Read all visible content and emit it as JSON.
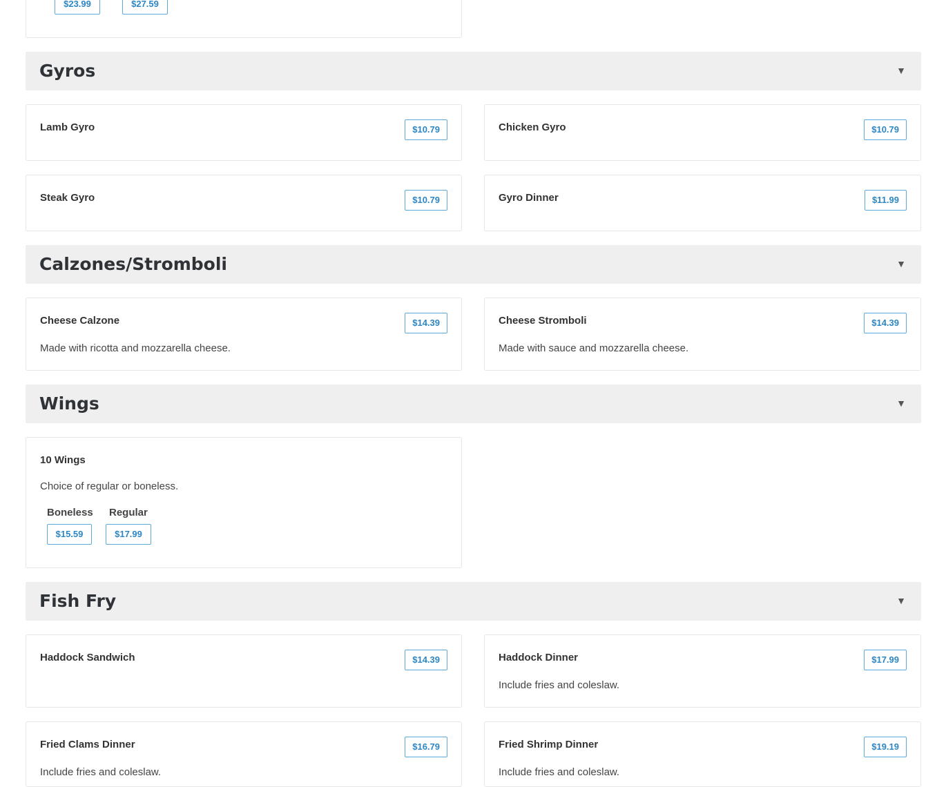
{
  "top_card": {
    "prices": [
      "$23.99",
      "$27.59"
    ]
  },
  "sections": {
    "gyros": {
      "title": "Gyros",
      "items": [
        {
          "name": "Lamb Gyro",
          "price": "$10.79"
        },
        {
          "name": "Chicken Gyro",
          "price": "$10.79"
        },
        {
          "name": "Steak Gyro",
          "price": "$10.79"
        },
        {
          "name": "Gyro Dinner",
          "price": "$11.99"
        }
      ]
    },
    "calzones": {
      "title": "Calzones/Stromboli",
      "items": [
        {
          "name": "Cheese Calzone",
          "price": "$14.39",
          "desc": "Made with ricotta and mozzarella cheese."
        },
        {
          "name": "Cheese Stromboli",
          "price": "$14.39",
          "desc": "Made with sauce and mozzarella cheese."
        }
      ]
    },
    "wings": {
      "title": "Wings",
      "items": [
        {
          "name": "10 Wings",
          "desc": "Choice of regular or boneless.",
          "options": [
            {
              "label": "Boneless",
              "price": "$15.59"
            },
            {
              "label": "Regular",
              "price": "$17.99"
            }
          ]
        }
      ]
    },
    "fish_fry": {
      "title": "Fish Fry",
      "items": [
        {
          "name": "Haddock Sandwich",
          "price": "$14.39"
        },
        {
          "name": "Haddock Dinner",
          "price": "$17.99",
          "desc": "Include fries and coleslaw."
        },
        {
          "name": "Fried Clams Dinner",
          "price": "$16.79",
          "desc": "Include fries and coleslaw."
        },
        {
          "name": "Fried Shrimp Dinner",
          "price": "$19.19",
          "desc": "Include fries and coleslaw."
        }
      ]
    }
  },
  "expand_glyph": "▼",
  "icons": {
    "section_toggle": "chevron-down-icon"
  },
  "colors": {
    "price_text": "#2d86c4",
    "price_border": "#5aa9d6",
    "section_bg": "#efefef"
  }
}
